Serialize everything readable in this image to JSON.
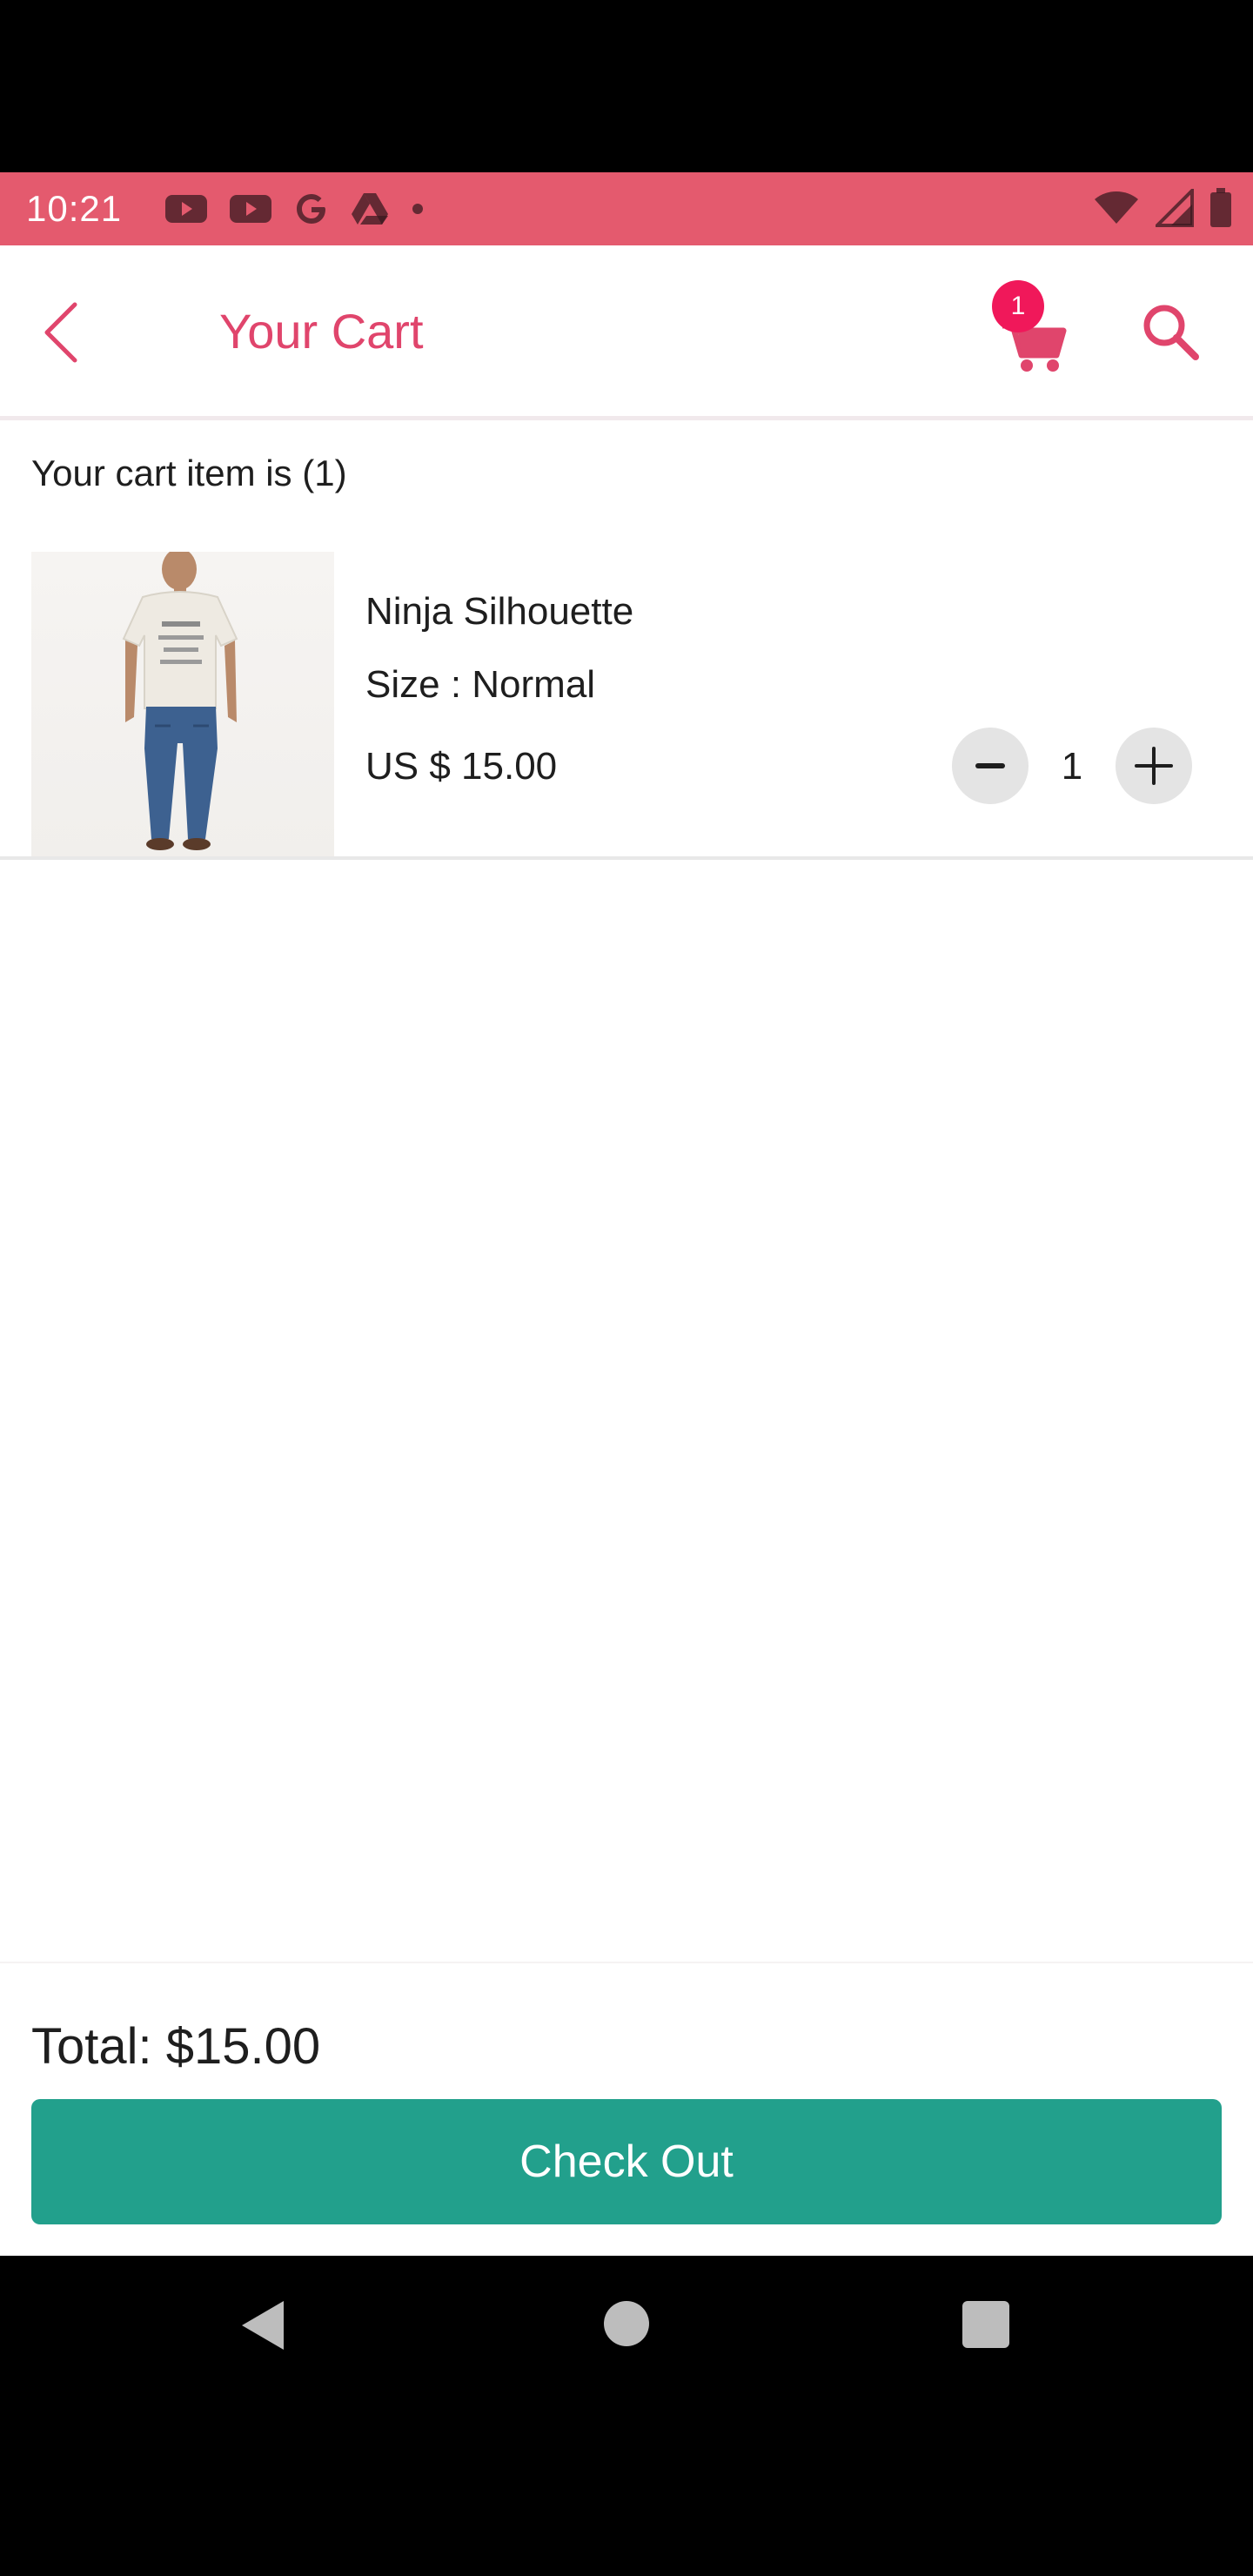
{
  "status_bar": {
    "time": "10:21",
    "left_icons": [
      "youtube-icon",
      "youtube-icon",
      "google-icon",
      "drive-icon",
      "dot-icon"
    ],
    "right_icons": [
      "wifi-icon",
      "signal-icon",
      "battery-icon"
    ],
    "background": "#e45a6e"
  },
  "header": {
    "title": "Your Cart",
    "cart_badge": "1",
    "accent_color": "#e0456c"
  },
  "cart": {
    "count_label": "Your cart item is (1)",
    "items": [
      {
        "name": "Ninja Silhouette",
        "size": "Size : Normal",
        "price": "US $ 15.00",
        "quantity": "1",
        "image": "man-in-tshirt-and-jeans"
      }
    ]
  },
  "footer": {
    "total": "Total: $15.00",
    "checkout_label": "Check Out",
    "button_color": "#22a08c"
  },
  "nav": {
    "buttons": [
      "back-icon",
      "home-icon",
      "recents-icon"
    ]
  }
}
